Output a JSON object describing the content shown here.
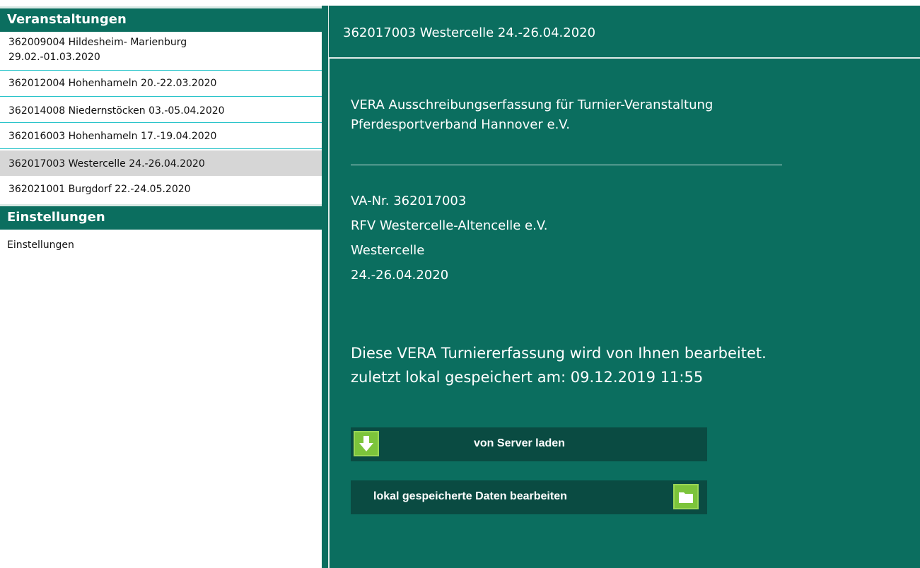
{
  "sidebar": {
    "veranstaltungen_header": "Veranstaltungen",
    "events": [
      {
        "line1": "362009004 Hildesheim- Marienburg",
        "line2": "29.02.-01.03.2020",
        "selected": false
      },
      {
        "line1": "362012004 Hohenhameln 20.-22.03.2020",
        "selected": false
      },
      {
        "line1": "362014008 Niedernstöcken 03.-05.04.2020",
        "selected": false
      },
      {
        "line1": "362016003 Hohenhameln 17.-19.04.2020",
        "selected": false
      },
      {
        "line1": "362017003 Westercelle 24.-26.04.2020",
        "selected": true
      },
      {
        "line1": "362021001 Burgdorf 22.-24.05.2020",
        "selected": false
      }
    ],
    "einstellungen_header": "Einstellungen",
    "settings_item": "Einstellungen"
  },
  "main": {
    "title": "362017003 Westercelle 24.-26.04.2020",
    "intro": {
      "line1": "VERA Ausschreibungserfassung für Turnier-Veranstaltung",
      "line2": "Pferdesportverband Hannover e.V."
    },
    "details": {
      "va_nr": "VA-Nr. 362017003",
      "club": "RFV Westercelle-Altencelle e.V.",
      "place": "Westercelle",
      "dates": "24.-26.04.2020"
    },
    "status": {
      "line1": "Diese VERA Turniererfassung wird von Ihnen bearbeitet.",
      "line2": "zuletzt lokal gespeichert am: 09.12.2019 11:55"
    },
    "buttons": {
      "server_label": "von Server laden",
      "local_label": "lokal gespeicherte Daten bearbeiten"
    }
  },
  "colors": {
    "primary_green": "#0b6e5f",
    "button_dark": "#0a4b42",
    "icon_green": "#7cc43b",
    "selected_bg": "#d6d6d6",
    "separator_cyan": "#26c3c9"
  }
}
